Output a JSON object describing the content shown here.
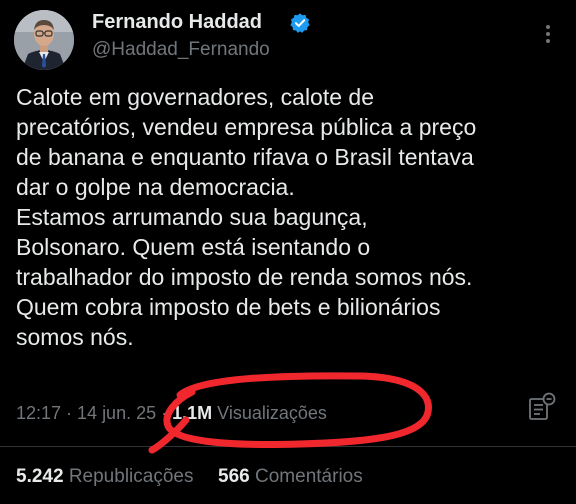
{
  "author": {
    "display_name": "Fernando Haddad",
    "handle": "@Haddad_Fernando",
    "verified_icon": "verified-badge-icon",
    "verified_color": "#1d9bf0"
  },
  "tweet": {
    "lines": [
      "Calote em governadores, calote de",
      "precatórios, vendeu empresa pública a preço",
      "de banana e enquanto rifava o Brasil tentava",
      "dar o golpe na democracia.",
      "Estamos arrumando sua bagunça,",
      "Bolsonaro. Quem está isentando o",
      "trabalhador do imposto de renda somos nós.",
      "Quem cobra imposto de bets e bilionários",
      "somos nós."
    ]
  },
  "meta": {
    "time_date": "12:17 · 14 jun. 25 ·",
    "views_count": "1,1M",
    "views_label": "Visualizações"
  },
  "stats": {
    "reposts_count": "5.242",
    "reposts_label": "Republicações",
    "comments_count": "566",
    "comments_label": "Comentários"
  },
  "annotation": {
    "color": "#f0282d"
  }
}
